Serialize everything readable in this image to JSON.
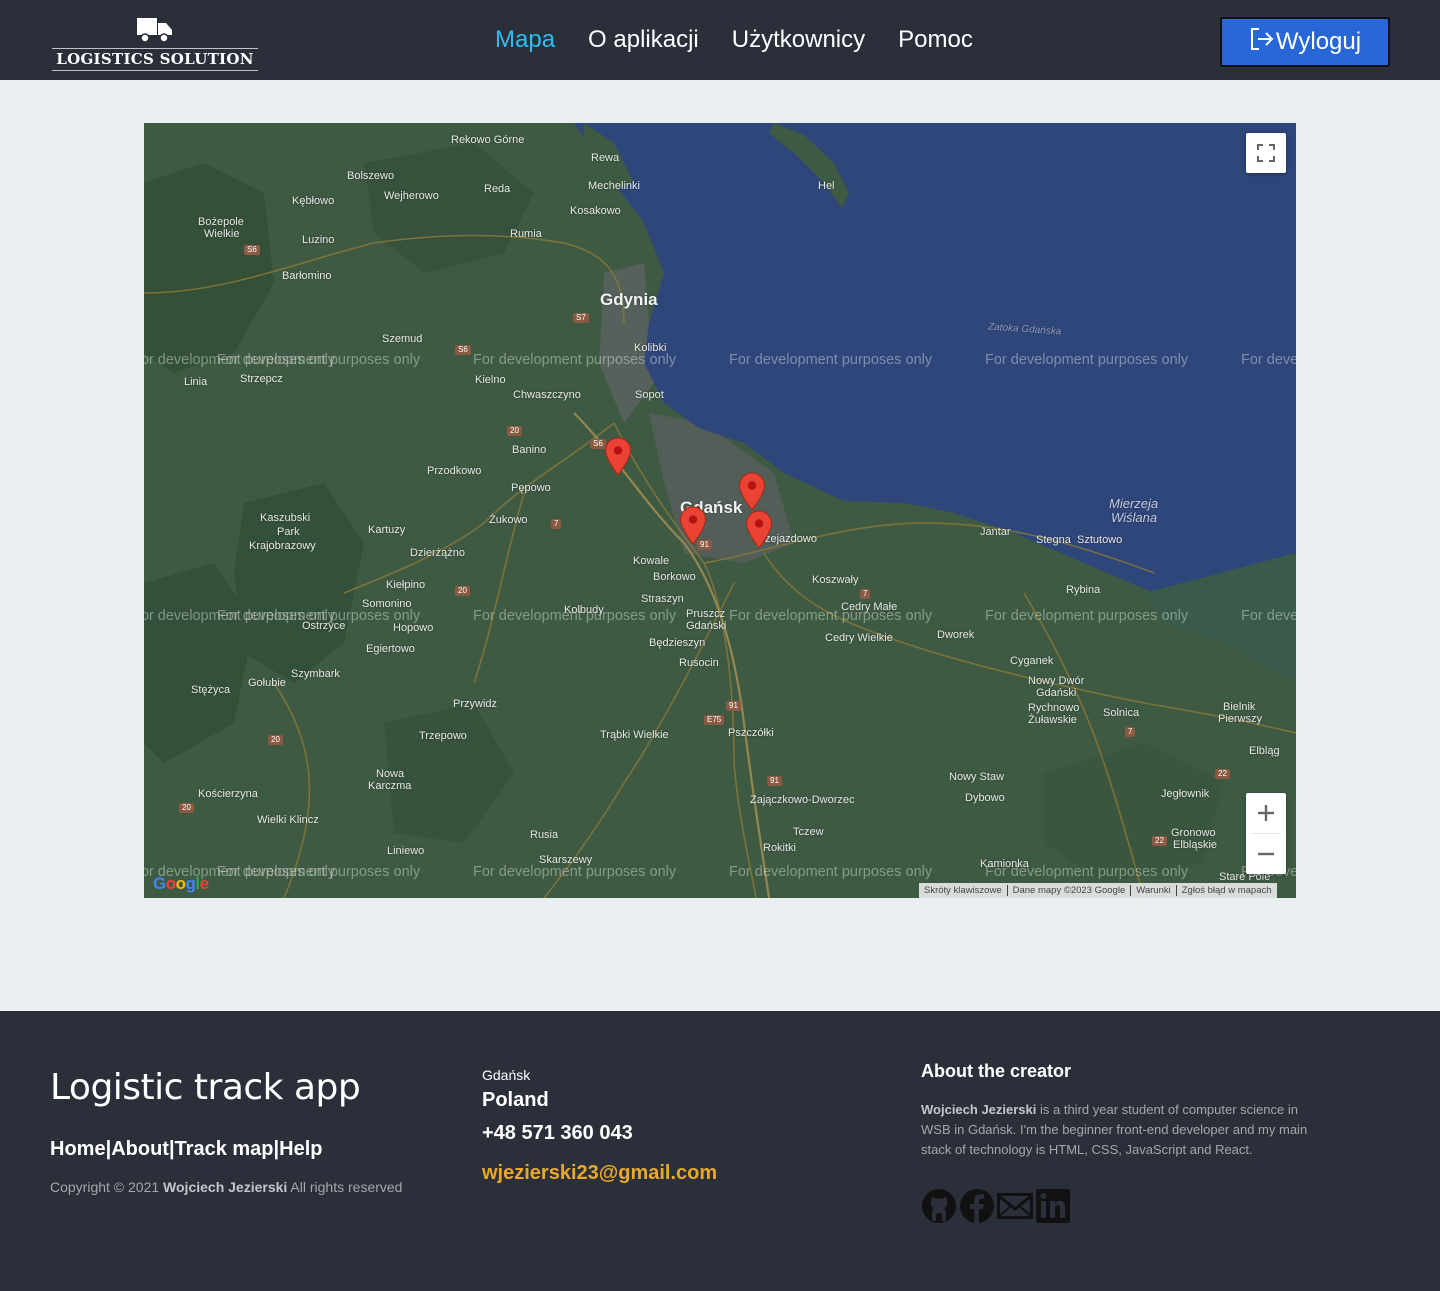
{
  "header": {
    "logo_text": "LOGISTICS SOLUTION",
    "nav": [
      {
        "label": "Mapa",
        "active": true
      },
      {
        "label": "O aplikacji",
        "active": false
      },
      {
        "label": "Użytkownicy",
        "active": false
      },
      {
        "label": "Pomoc",
        "active": false
      }
    ],
    "logout_label": "Wyloguj"
  },
  "map": {
    "watermark": "For development purposes only",
    "places": {
      "gdynia": "Gdynia",
      "gdansk": "Gdańsk",
      "sopot": "Sopot",
      "rumia": "Rumia",
      "reda": "Reda",
      "wejherowo": "Wejherowo",
      "rewa": "Rewa",
      "mechelinki": "Mechelinki",
      "kosakowo": "Kosakowo",
      "hel": "Hel",
      "rekowo": "Rekowo Górne",
      "bolszewo": "Bolszewo",
      "keblowo": "Kębłowo",
      "bozepole": "Bożepole",
      "wielkie": "Wielkie",
      "luzino": "Luzino",
      "barlomino": "Barłomino",
      "szemud": "Szemud",
      "kolibki": "Kolibki",
      "kielno": "Kielno",
      "chwaszczyno": "Chwaszczyno",
      "linia": "Linia",
      "strzepcz": "Strzepcz",
      "banino": "Banino",
      "przodkowo": "Przodkowo",
      "pepowo": "Pępowo",
      "zukowo": "Żukowo",
      "kartuzy": "Kartuzy",
      "kaszubski": "Kaszubski",
      "park": "Park",
      "krajobrazowy": "Krajobrazowy",
      "dzierzazno": "Dzierżążno",
      "kielpino": "Kiełpino",
      "somonino": "Somonino",
      "hopowo": "Hopowo",
      "ostrzyce": "Ostrzyce",
      "egiertowo": "Egiertowo",
      "kowale": "Kowale",
      "borkowo": "Borkowo",
      "straszyn": "Straszyn",
      "kolbudy": "Kolbudy",
      "pruszcz": "Pruszcz",
      "pruszcz2": "Gdański",
      "bedzieszyn": "Będzieszyn",
      "rusocin": "Rusocin",
      "przejazdowo": "Przejazdowo",
      "koszwaly": "Koszwały",
      "cedry_male": "Cedry Małe",
      "cedry_wielkie": "Cedry Wielkie",
      "jantar": "Jantar",
      "stegna": "Stegna",
      "sztutowo": "Sztutowo",
      "rybina": "Rybina",
      "dworek": "Dworek",
      "cyganek": "Cyganek",
      "nowy_dwor": "Nowy Dwór",
      "nowy_dwor2": "Gdański",
      "rychnowo": "Rychnowo",
      "zulawskie": "Żuławskie",
      "solnica": "Solnica",
      "bielnik": "Bielnik",
      "pierwszy": "Pierwszy",
      "elblag": "Elbląg",
      "nowy_staw": "Nowy Staw",
      "dybowo": "Dybowo",
      "jeglownik": "Jegłownik",
      "gronowo": "Gronowo",
      "elblaskie": "Elbląskie",
      "kamionka": "Kamionka",
      "stare_pole": "Stare Pole",
      "szymbark": "Szymbark",
      "golubie": "Gołubie",
      "stezyca": "Stężyca",
      "przywidz": "Przywidz",
      "trzepowo": "Trzepowo",
      "trabki": "Trąbki Wielkie",
      "pszczolki": "Pszczółki",
      "nowa_karczma": "Nowa",
      "nowa_karczma2": "Karczma",
      "koscierzyna": "Kościerzyna",
      "wielki_klincz": "Wielki Klincz",
      "liniewo": "Liniewo",
      "rusia": "Rusia",
      "skarszewy": "Skarszewy",
      "tczew": "Tczew",
      "rokitki": "Rokitki",
      "zajaczkowo": "Zajączkowo-Dworzec",
      "zatoka": "Zatoka Gdańska",
      "mierzeja": "Mierzeja",
      "wislana": "Wiślana"
    },
    "zoom_in": "+",
    "zoom_out": "−",
    "google": "Google",
    "attribution": [
      "Skróty klawiszowe",
      "Dane mapy ©2023 Google",
      "Warunki",
      "Zgłoś błąd w mapach"
    ]
  },
  "footer": {
    "title": "Logistic track app",
    "links": [
      "Home",
      "About",
      "Track map",
      "Help"
    ],
    "copyright_prefix": "Copyright © 2021",
    "copyright_name": "Wojciech Jezierski",
    "copyright_suffix": "All rights reserved",
    "city": "Gdańsk",
    "country": "Poland",
    "phone": "+48 571 360 043",
    "email": "wjezierski23@gmail.com",
    "about_title": "About the creator",
    "about_name": "Wojciech Jezierski",
    "about_text": "is a third year student of computer science in WSB in Gdańsk. I'm the beginner front-end developer and my main stack of technology is HTML, CSS, JavaScript and React.",
    "social": [
      "github-icon",
      "facebook-icon",
      "mail-icon",
      "linkedin-icon"
    ]
  },
  "colors": {
    "navbar_bg": "#2a2f3a",
    "active_link": "#2dbdf0",
    "logout_bg": "#2767d8",
    "email": "#e8a92b",
    "page_bg": "#e9eef1",
    "map_sea": "#2f467a",
    "map_land": "#3e5a43"
  }
}
